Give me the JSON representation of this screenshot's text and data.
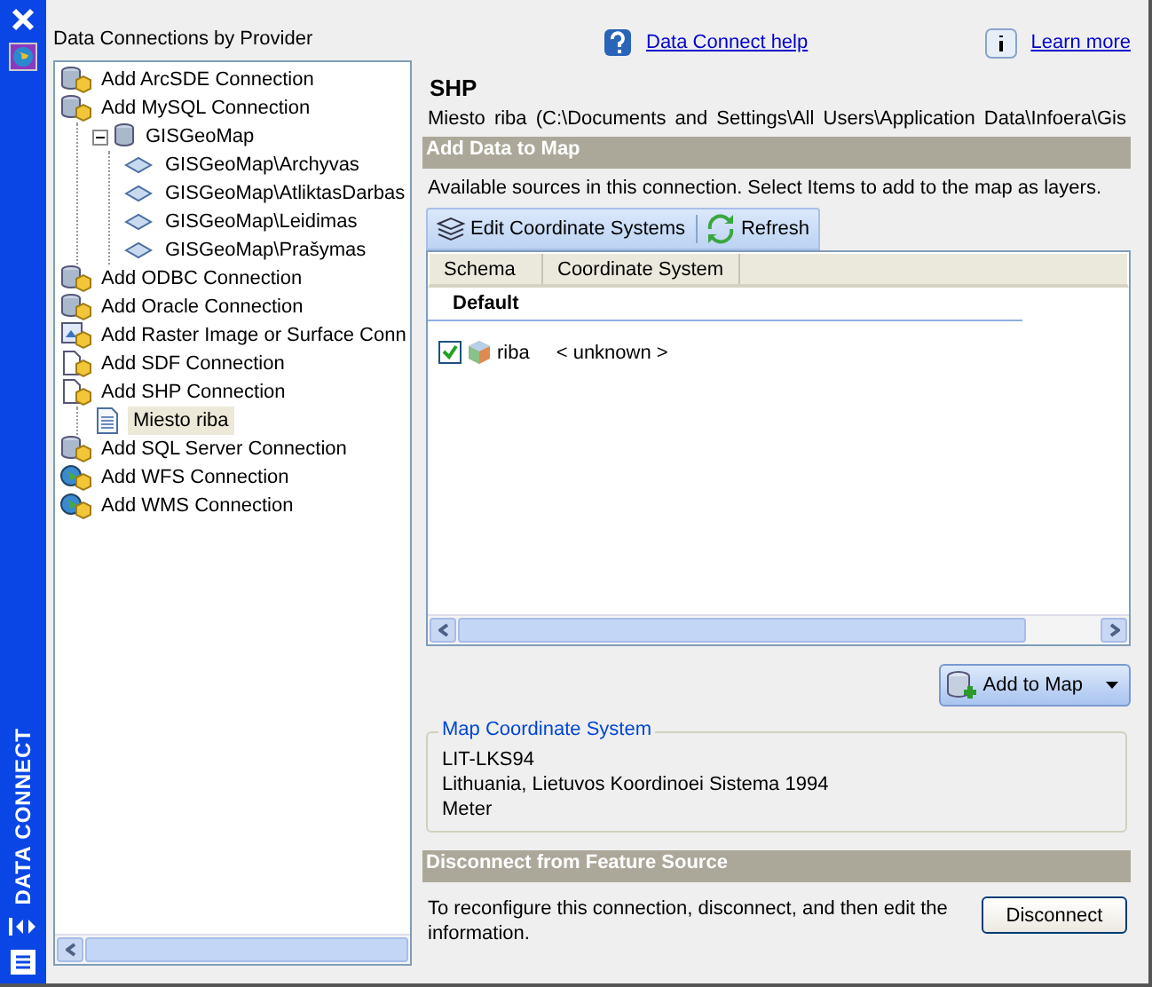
{
  "palette": {
    "title": "DATA CONNECT"
  },
  "tree": {
    "title": "Data Connections by Provider",
    "items": [
      {
        "label": "Add ArcSDE Connection",
        "kind": "database",
        "selected": false
      },
      {
        "label": "Add MySQL Connection",
        "kind": "database",
        "selected": false,
        "children": [
          {
            "label": "GISGeoMap",
            "kind": "store",
            "selected": false,
            "expanded": true,
            "children": [
              {
                "label": "GISGeoMap\\Archyvas",
                "kind": "schema",
                "selected": false
              },
              {
                "label": "GISGeoMap\\AtliktasDarbas",
                "kind": "schema",
                "selected": false
              },
              {
                "label": "GISGeoMap\\Leidimas",
                "kind": "schema",
                "selected": false
              },
              {
                "label": "GISGeoMap\\Prašymas",
                "kind": "schema",
                "selected": false
              }
            ]
          }
        ]
      },
      {
        "label": "Add ODBC Connection",
        "kind": "database",
        "selected": false
      },
      {
        "label": "Add Oracle Connection",
        "kind": "database",
        "selected": false
      },
      {
        "label": "Add Raster Image or Surface Conn",
        "kind": "raster",
        "selected": false
      },
      {
        "label": "Add SDF Connection",
        "kind": "file",
        "selected": false
      },
      {
        "label": "Add SHP Connection",
        "kind": "file",
        "selected": false,
        "children": [
          {
            "label": "Miesto riba",
            "kind": "document",
            "selected": true
          }
        ]
      },
      {
        "label": "Add SQL Server Connection",
        "kind": "database",
        "selected": false
      },
      {
        "label": "Add WFS Connection",
        "kind": "web",
        "selected": false
      },
      {
        "label": "Add WMS Connection",
        "kind": "web",
        "selected": false
      }
    ]
  },
  "help_links": [
    {
      "label": "Data Connect help",
      "kind": "help"
    },
    {
      "label": "Learn more",
      "kind": "info"
    }
  ],
  "details": {
    "heading": "SHP",
    "path": "Miesto riba (C:\\Documents and Settings\\All Users\\Application Data\\Infoera\\Gis"
  },
  "add_data": {
    "title": "Add Data to Map",
    "description": "Available sources in this connection.  Select Items to add to the map as layers.",
    "toolbar": [
      {
        "label": "Edit Coordinate Systems",
        "kind": "layers"
      },
      {
        "label": "Refresh",
        "kind": "refresh"
      }
    ],
    "columns": [
      "Schema",
      "Coordinate System"
    ],
    "groups": [
      {
        "name": "Default",
        "rows": [
          {
            "schema": "riba",
            "coordinate_system": "< unknown >",
            "checked": true
          }
        ]
      }
    ],
    "add_button": "Add to Map"
  },
  "map_cs": {
    "title": "Map Coordinate System",
    "lines": [
      "LIT-LKS94",
      "Lithuania, Lietuvos Koordinoei Sistema 1994",
      "Meter"
    ]
  },
  "disconnect": {
    "title": "Disconnect from Feature Source",
    "description": "To reconfigure this connection, disconnect, and then edit the information.",
    "button": "Disconnect"
  }
}
